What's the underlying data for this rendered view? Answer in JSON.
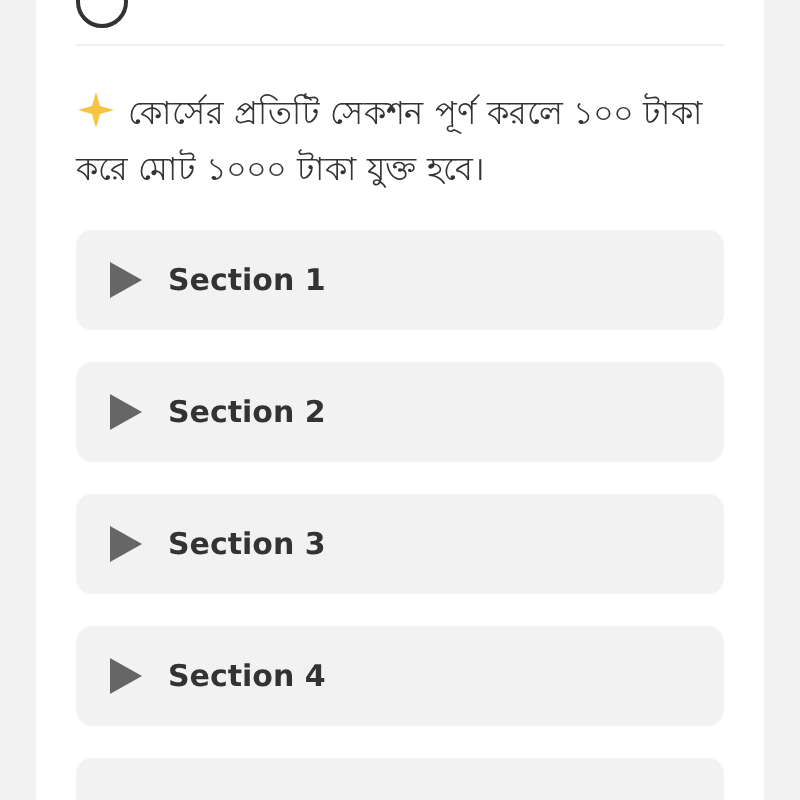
{
  "notice": {
    "text": "কোর্সের প্রতিটি সেকশন পূর্ণ করলে ১০০ টাকা করে মোট ১০০০ টাকা যুক্ত হবে।"
  },
  "sections": [
    {
      "title": "Section 1"
    },
    {
      "title": "Section 2"
    },
    {
      "title": "Section 3"
    },
    {
      "title": "Section 4"
    }
  ]
}
